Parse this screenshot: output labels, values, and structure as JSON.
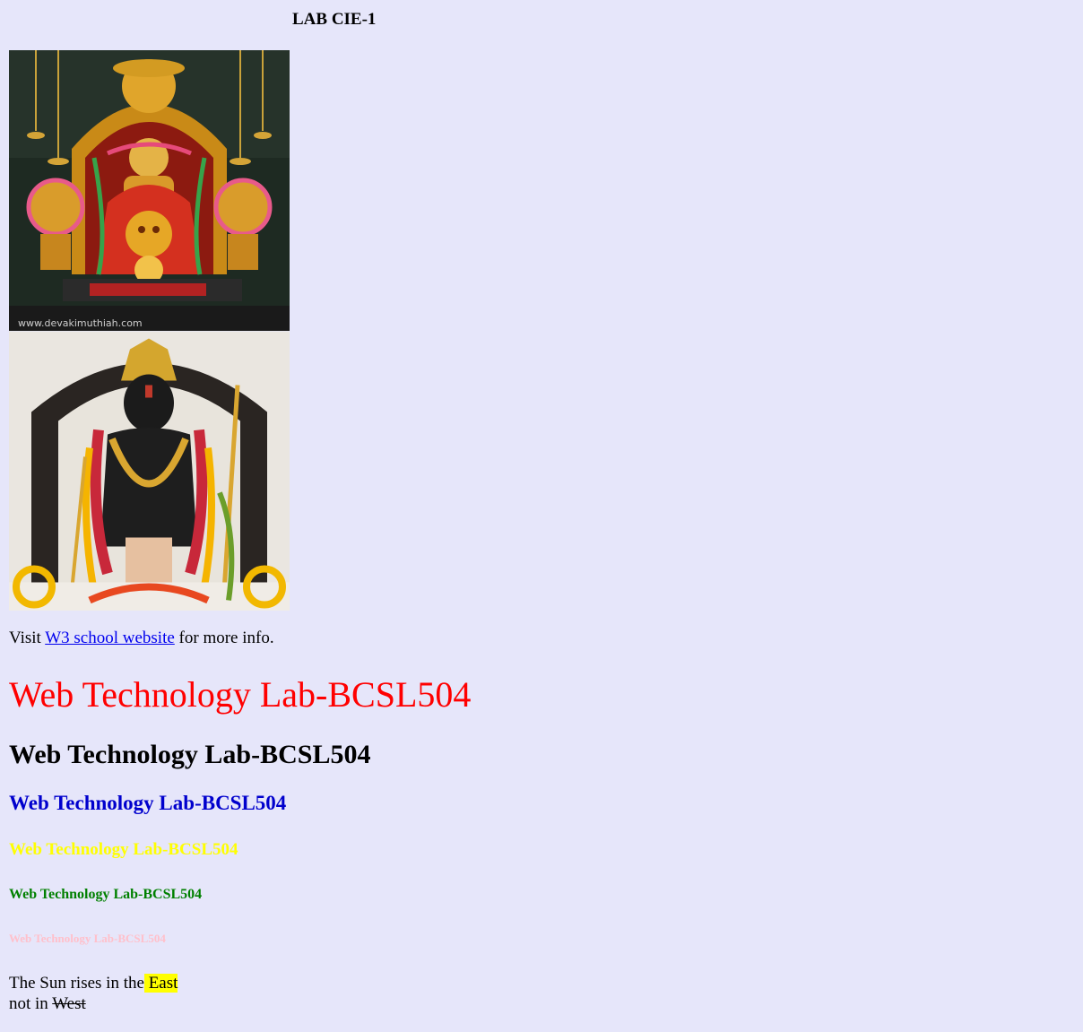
{
  "page": {
    "title": "LAB CIE-1",
    "background_color": "#e6e6fa"
  },
  "images": [
    {
      "name": "temple-deity-image",
      "watermark": "www.devakimuthiah.com"
    },
    {
      "name": "ram-idol-image"
    }
  ],
  "visit_line": {
    "prefix": "Visit ",
    "link_text": "W3 school website",
    "suffix": " for more info."
  },
  "headings": [
    {
      "level": 1,
      "text": "Web Technology Lab-BCSL504",
      "color": "#ff0000"
    },
    {
      "level": 2,
      "text": "Web Technology Lab-BCSL504",
      "color": "#000000"
    },
    {
      "level": 3,
      "text": "Web Technology Lab-BCSL504",
      "color": "#0000cd"
    },
    {
      "level": 4,
      "text": "Web Technology Lab-BCSL504",
      "color": "#ffff00"
    },
    {
      "level": 5,
      "text": "Web Technology Lab-BCSL504",
      "color": "#008000"
    },
    {
      "level": 6,
      "text": "Web Technology Lab-BCSL504",
      "color": "#ffc0cb"
    }
  ],
  "sun_text": {
    "line1_prefix": "The Sun rises in the",
    "highlight": " East",
    "line2_prefix": "not in ",
    "strike": "West"
  }
}
